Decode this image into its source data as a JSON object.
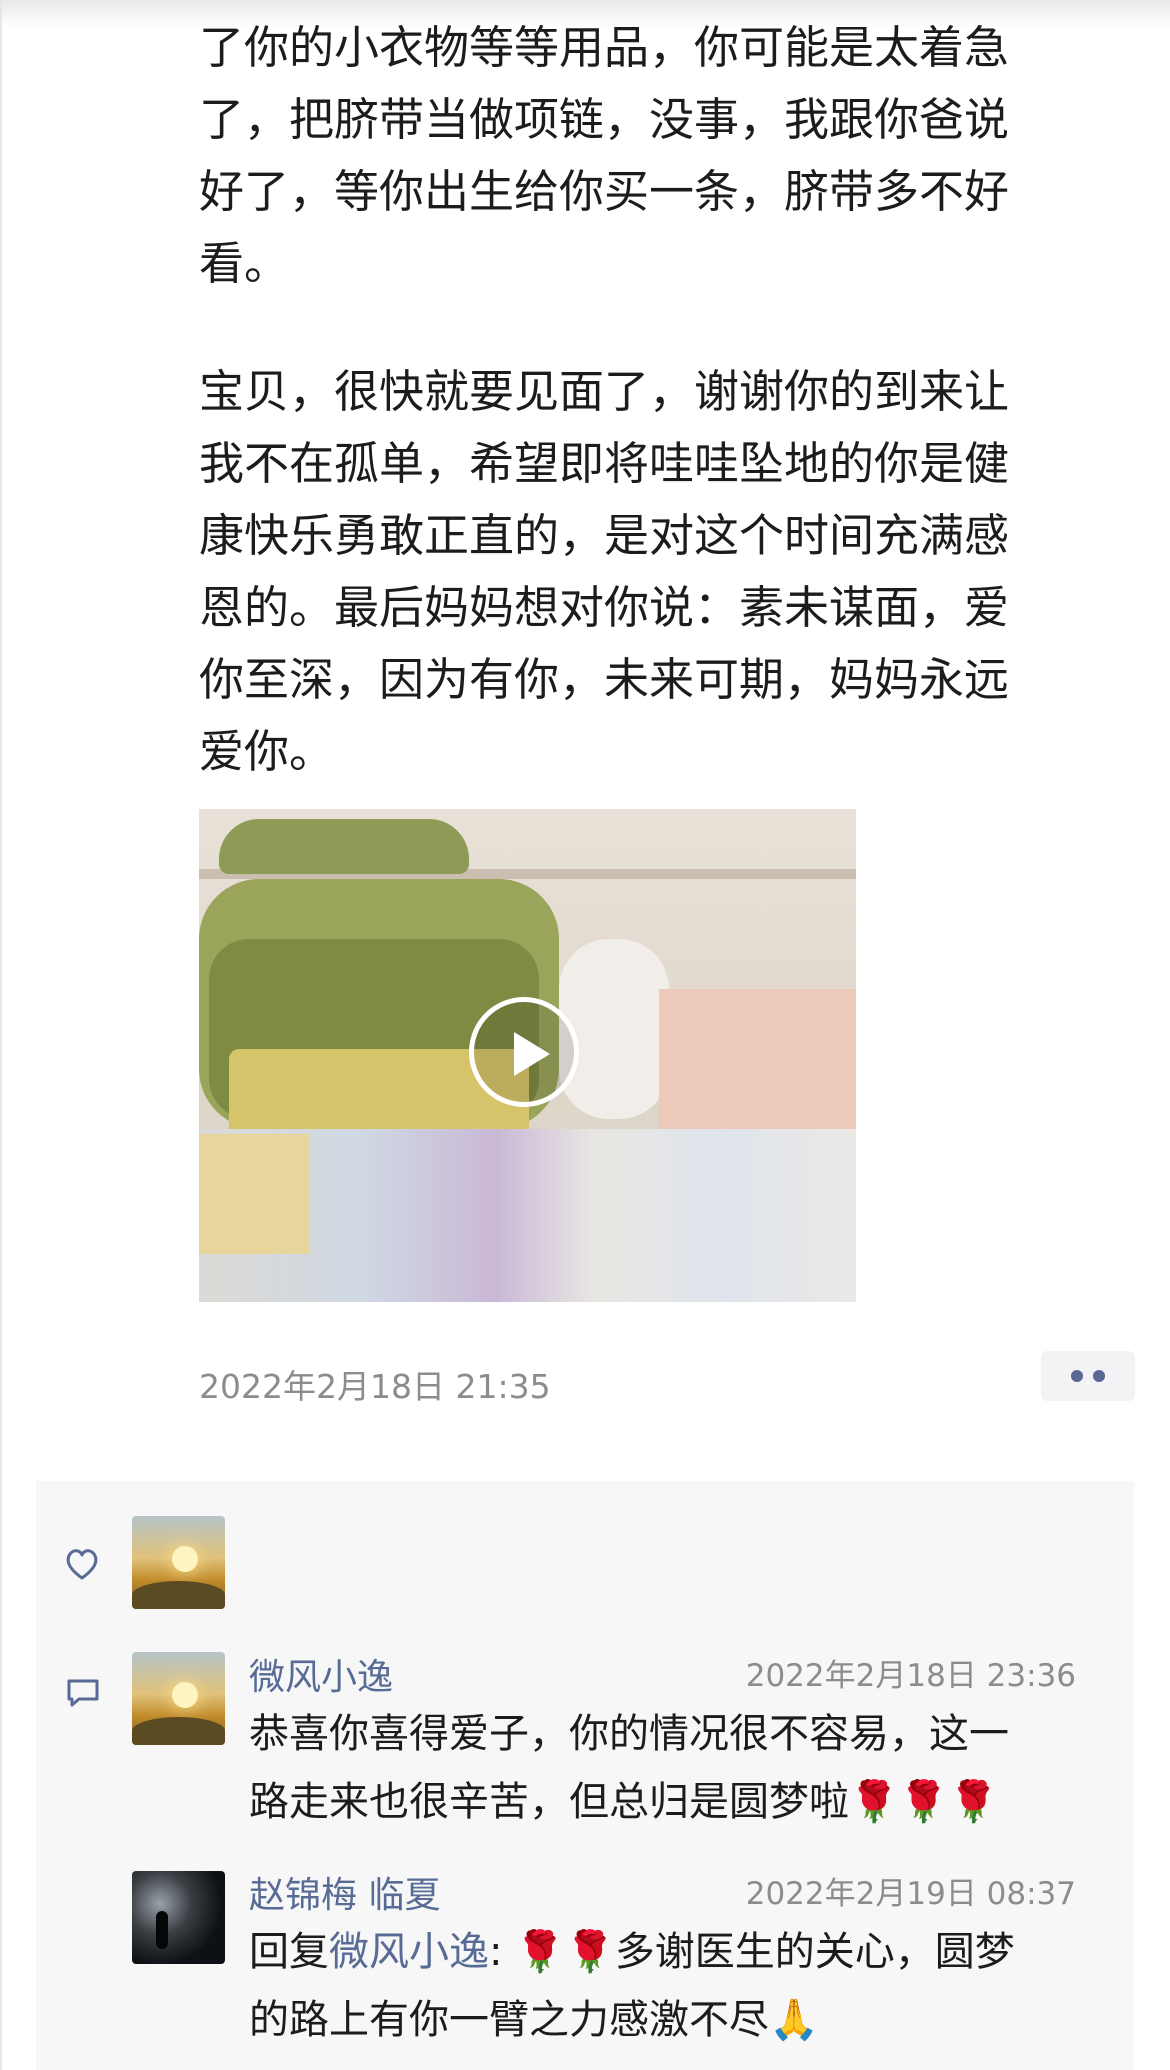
{
  "post": {
    "paragraph1": "了你的小衣物等等用品，你可能是太着急\n了，把脐带当做项链，没事，我跟你爸说\n好了，等你出生给你买一条，脐带多不好\n看。",
    "paragraph2": "宝贝，很快就要见面了，谢谢你的到来让\n我不在孤单，希望即将哇哇坠地的你是健\n康快乐勇敢正直的，是对这个时间充满感\n恩的。最后妈妈想对你说：素未谋面，爱\n你至深，因为有你，未来可期，妈妈永远\n爱你。",
    "timestamp": "2022年2月18日 21:35"
  },
  "icons": {
    "like": "heart-outline-icon",
    "comment": "comment-bubble-icon",
    "more": "more-dots-icon",
    "play": "play-icon",
    "rose": "🌹",
    "folded_hands": "🙏"
  },
  "colors": {
    "link": "#576b95",
    "timestamp": "#8c8c8c",
    "comment_bg": "#f7f7f7"
  },
  "comments": [
    {
      "name": "微风小逸",
      "time": "2022年2月18日 23:36",
      "text": "恭喜你喜得爱子，你的情况很不容易，这一\n路走来也很辛苦，但总归是圆梦啦",
      "emojis": "🌹🌹🌹"
    },
    {
      "name": "赵锦梅 临夏",
      "time": "2022年2月19日 08:37",
      "reply_prefix": "回复",
      "reply_to": "微风小逸",
      "reply_sep": ":",
      "emojis_lead": "🌹🌹",
      "text_line1": "多谢医生的关心，圆梦",
      "text_line2": "的路上有你一臂之力感激不尽",
      "emoji_tail": "🙏"
    }
  ]
}
